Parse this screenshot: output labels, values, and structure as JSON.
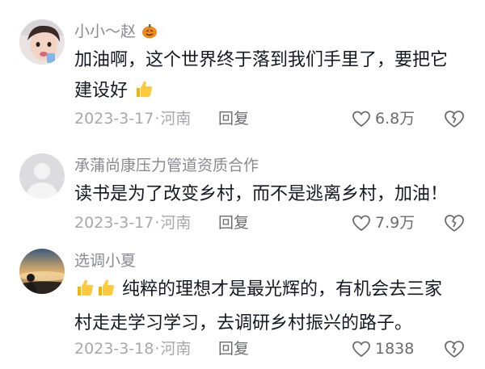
{
  "comments": [
    {
      "username": "小小～赵",
      "username_emoji": "pumpkin-icon",
      "text": "加油啊，这个世界终于落到我们手里了，要把它建设好",
      "text_emoji": "thumbs-up-icon",
      "date": "2023-3-17",
      "dot": "·",
      "location": "河南",
      "reply_label": "回复",
      "likes": "6.8万"
    },
    {
      "username": "承蒲尚康压力管道资质合作",
      "text": "读书是为了改变乡村，而不是逃离乡村，加油！",
      "date": "2023-3-17",
      "dot": "·",
      "location": "河南",
      "reply_label": "回复",
      "likes": "7.9万"
    },
    {
      "username": "选调小夏",
      "text_prefix_emoji": "thumbs-up-icon",
      "text": "纯粹的理想才是最光辉的，有机会去三家村走走学习学习，去调研乡村振兴的路子。",
      "date": "2023-3-18",
      "dot": "·",
      "location": "河南",
      "reply_label": "回复",
      "likes": "1838"
    }
  ],
  "colors": {
    "username": "#8a8b91",
    "text": "#161823",
    "meta": "#a7a8ad",
    "action": "#6b6c72"
  }
}
